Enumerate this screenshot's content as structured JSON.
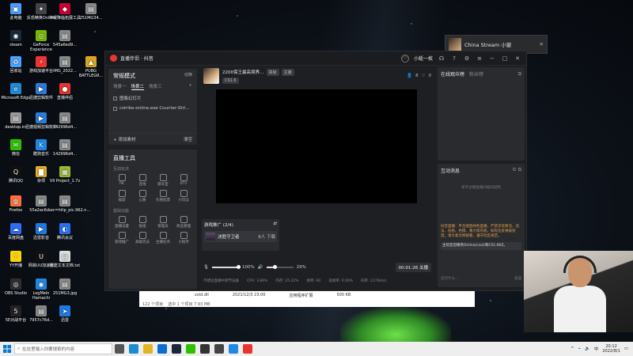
{
  "desktop_icons": [
    {
      "label": "此电脑",
      "color": "#4aa3ff",
      "glyph": "▣"
    },
    {
      "label": "反恐精英Online",
      "color": "#444",
      "glyph": "✦"
    },
    {
      "label": "神曜降临拓展工具",
      "color": "#c03",
      "glyph": "◆"
    },
    {
      "label": "251MG34...",
      "color": "#888",
      "glyph": "▤"
    },
    {
      "label": "steam",
      "color": "#1b2838",
      "glyph": "◉"
    },
    {
      "label": "GeForce Experience",
      "color": "#76b900",
      "glyph": "◎"
    },
    {
      "label": "545a6ed9...",
      "color": "#888",
      "glyph": "▤"
    },
    {
      "label": "回收站",
      "color": "#4aa3ff",
      "glyph": "♻"
    },
    {
      "label": "游戏加速平台",
      "color": "#e33",
      "glyph": "⚡"
    },
    {
      "label": "IMG_2022...",
      "color": "#888",
      "glyph": "▤"
    },
    {
      "label": "PUBG BATTLEGR...",
      "color": "#d9a520",
      "glyph": "▲"
    },
    {
      "label": "Microsoft Edge",
      "color": "#1c8bd6",
      "glyph": "e"
    },
    {
      "label": "迅捷剪辑软件",
      "color": "#2e7bd6",
      "glyph": "▶"
    },
    {
      "label": "直播伴侣",
      "color": "#e8352f",
      "glyph": "●"
    },
    {
      "label": "desktop.ini",
      "color": "#999",
      "glyph": "▤"
    },
    {
      "label": "迅捷视频剪辑软件",
      "color": "#2e7bd6",
      "glyph": "▶"
    },
    {
      "label": "142996d4...",
      "color": "#888",
      "glyph": "▤"
    },
    {
      "label": "微信",
      "color": "#2dc100",
      "glyph": "✉"
    },
    {
      "label": "酷狗音乐",
      "color": "#1e88e5",
      "glyph": "K"
    },
    {
      "label": "142996d4...",
      "color": "#888",
      "glyph": "▤"
    },
    {
      "label": "腾讯QQ",
      "color": "#111",
      "glyph": "Q"
    },
    {
      "label": "杂项",
      "color": "#e6b422",
      "glyph": "▇"
    },
    {
      "label": "VII Project_1.7z",
      "color": "#9b3",
      "glyph": "▦"
    },
    {
      "label": "Firefox",
      "color": "#ff7139",
      "glyph": "◍"
    },
    {
      "label": "55a2ac6d...",
      "color": "#888",
      "glyph": "▤"
    },
    {
      "label": "src=http_pic.962.n...",
      "color": "#888",
      "glyph": "▤"
    },
    {
      "label": "百度网盘",
      "color": "#2f6df6",
      "glyph": "☁"
    },
    {
      "label": "迅雷影音",
      "color": "#1f7ae0",
      "glyph": "▶"
    },
    {
      "label": "腾讯会议",
      "color": "#2a6ff6",
      "glyph": "◐"
    },
    {
      "label": "YY开播",
      "color": "#ffd400",
      "glyph": "Y"
    },
    {
      "label": "网易UU加速器",
      "color": "#111",
      "glyph": "U"
    },
    {
      "label": "新建文本文档.txt",
      "color": "#ddd",
      "glyph": "▤"
    },
    {
      "label": "OBS Studio",
      "color": "#302e31",
      "glyph": "◎"
    },
    {
      "label": "LogMeIn Hamachi",
      "color": "#1e88e5",
      "glyph": "◉"
    },
    {
      "label": "251MG3.jpg",
      "color": "#888",
      "glyph": "▤"
    },
    {
      "label": "5E对战平台",
      "color": "#222",
      "glyph": "5"
    },
    {
      "label": "7957c76d...",
      "color": "#888",
      "glyph": "▤"
    },
    {
      "label": "迅雷",
      "color": "#1f7ae0",
      "glyph": "➤"
    }
  ],
  "window": {
    "app_title": "直播伴侣 · 抖音",
    "user_name": "小蚯一枚",
    "live_mode": "常规模式",
    "switch_label": "切换",
    "scene_tabs": [
      "场景一",
      "场景二",
      "场景三"
    ],
    "sources": [
      "图像幻灯片",
      "cstrike-online.exe Counter-Stri..."
    ],
    "add_source": "+ 添加素材",
    "clear_label": "清空",
    "tools_title": "直播工具",
    "tools_cat1": "互动玩法",
    "tools_row1": [
      "PK",
      "连线",
      "聊天室",
      "KTV"
    ],
    "tools_row2": [
      "福袋",
      "心愿",
      "礼物投票",
      "小玩法"
    ],
    "tools_cat2": "基础功能",
    "tools_row3": [
      "直播设置",
      "贴纸",
      "管理员",
      "商品管理"
    ],
    "tools_row4": [
      "游戏推广",
      "高级玩法",
      "主播任务",
      "小程序"
    ]
  },
  "stream": {
    "title": "2200保王最高境界…",
    "tag_game": "CS1.6",
    "tags": [
      "高级",
      "主播"
    ],
    "viewer_count": "8",
    "like_count": "0",
    "promo_title": "游戏推广 (2/4)",
    "promo_item": "决胜守卫者",
    "promo_people": "8人 下载",
    "vol1": "100%",
    "vol2": "29%",
    "timer": "00:01:26",
    "end_label": "关播",
    "status": [
      "不建议直播中调节设备",
      "CPU: 3.86%",
      "内存: 25.22%",
      "帧率: 60",
      "丢帧率: 0.00%",
      "码率: 2176kb/s"
    ]
  },
  "right": {
    "audience_tab": "在线观众榜",
    "fans_tab": "粉丝榜",
    "interact_title": "互动消息",
    "gray_note": "新手主播直播间规则说明",
    "notice": "抖音直播：平台提倡绿色直播，严禁涉及政治、违法、低俗、色情、暴力等内容，如有违反将被封禁。请大家文明观看，遵守社区规范。",
    "msg_user": "主玩反恐精英Online(csol)和CS1.6KZ。",
    "input_placeholder": "说点什么...",
    "send_label": "发送"
  },
  "china_stream": {
    "label": "China Stream 小窗"
  },
  "explorer": {
    "file": "zold.dll",
    "date": "2021/12/3 23:00",
    "type": "应用程序扩展",
    "size": "500 KB",
    "count": "122 个项目",
    "selected": "选中 1 个项目 7.93 MB"
  },
  "taskbar": {
    "search_placeholder": "在这里输入你要搜索的内容",
    "time": "20:12",
    "date": "2022/8/1"
  }
}
